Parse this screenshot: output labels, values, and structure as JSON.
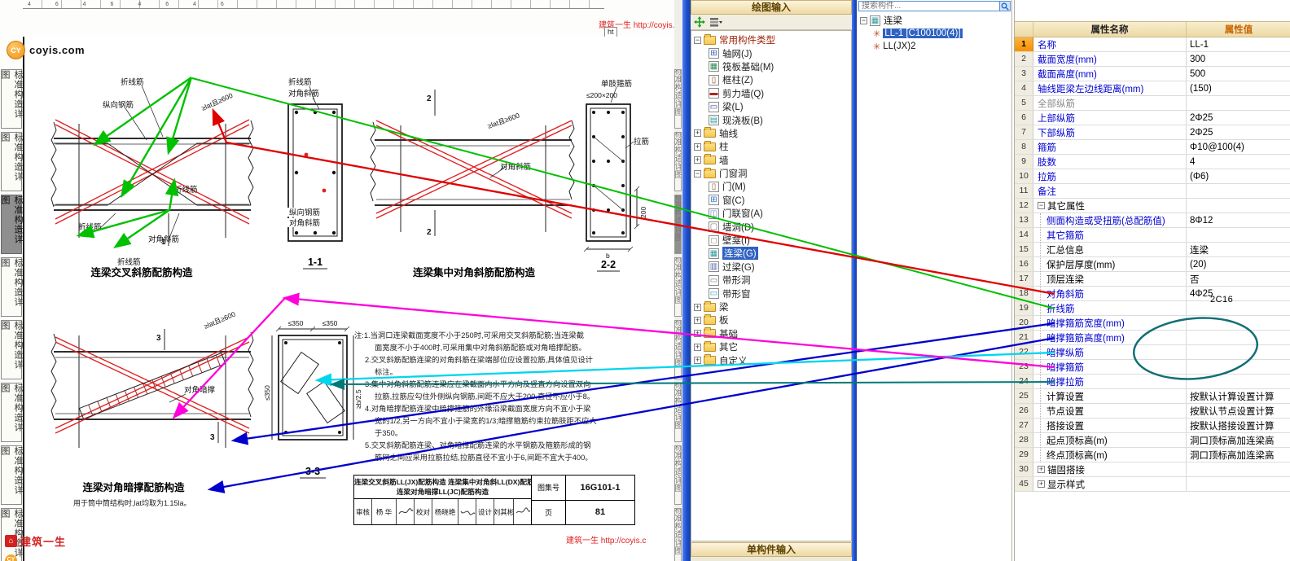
{
  "colors": {
    "arrow_green": "#00c000",
    "arrow_red": "#e00000",
    "arrow_blue": "#0000cc",
    "arrow_cyan": "#00d5ee",
    "arrow_magenta": "#ff00dd",
    "arrow_teal": "#007878",
    "ellipse_teal": "#136f75",
    "red_line": "#e02020",
    "selection_blue": "#2f62c2",
    "value_header_orange": "#c86400",
    "prop_blue": "#0000d0"
  },
  "doc": {
    "top_fragment": "4 6 4 6 4 6 4 6",
    "top_watermark": "建筑一生 http://coyis.",
    "top_tooltip": "ht",
    "logo_cy": "CY",
    "logo_site": "coyis.com",
    "side_tabs": [
      "标准构造详图",
      "标准构造详图",
      "标准构造详图",
      "标准构造详图",
      "标准构造详图",
      "标准构造详图",
      "标准构造详图",
      "标准构造详图"
    ],
    "side_tab_active_index": 2,
    "bottom_logo": "建筑一生",
    "bottom_watermark": "建筑一生 http://coyis.c",
    "labels": {
      "zhexianjin": "折线筋",
      "zongxiang": "纵向钢筋",
      "duijiao": "对角斜筋",
      "ancheng": "对角暗撑",
      "lajin": "拉筋",
      "danzhigujin": "单肢箍筋",
      "le200": "≤200×200",
      "dim600": "≥lat且≥600",
      "le350": "≤350",
      "geb25": "≥b/2.5",
      "d200": "200",
      "b": "b",
      "s1": "1",
      "s2": "2",
      "s3": "3",
      "c11": "1-1",
      "c22": "2-2",
      "c33": "3-3",
      "fig1_title": "连梁交叉斜筋配筋构造",
      "fig3_title": "连梁集中对角斜筋配筋构造",
      "fig5_title": "连梁对角暗撑配筋构造",
      "fig5_note": "用于筒中筒结构时,lat均取为1.15la。"
    },
    "notes": [
      {
        "t": "注:1.当洞口连梁截面宽度不小于250时,可采用交叉斜筋配筋;当连梁截",
        "i": 0
      },
      {
        "t": "面宽度不小于400时,可采用集中对角斜筋配筋或对角暗撑配筋。",
        "i": 2
      },
      {
        "t": "2.交叉斜筋配筋连梁的对角斜筋在梁端部位应设置拉筋,具体值见设计",
        "i": 1
      },
      {
        "t": "标注。",
        "i": 2
      },
      {
        "t": "3.集中对角斜筋配筋连梁应在梁截面内水平方向及竖直方向设置双向",
        "i": 1
      },
      {
        "t": "拉筋,拉筋应勾住外侧纵向钢筋,间距不应大于200,直径不应小于8。",
        "i": 2
      },
      {
        "t": "4.对角暗撑配筋连梁中暗撑箍筋的外缘沿梁截面宽度方向不宜小于梁",
        "i": 1
      },
      {
        "t": "宽的1/2,另一方向不宜小于梁宽的1/3;暗撑箍筋约束拉筋肢距不应大",
        "i": 2
      },
      {
        "t": "于350。",
        "i": 2
      },
      {
        "t": "5.交叉斜筋配筋连梁、对角暗撑配筋连梁的水平钢筋及箍筋形成的钢",
        "i": 1
      },
      {
        "t": "筋网之间应采用拉筋拉结,拉筋直径不宜小于6,间距不宜大于400。",
        "i": 2
      }
    ],
    "titleblock": {
      "line1": "连梁交叉斜筋LL(JX)配筋构造  连梁集中对角斜LL(DX)配筋构造",
      "line2": "连梁对角暗撑LL(JC)配筋构造",
      "atlas_label": "图集号",
      "atlas_no": "16G101-1",
      "page_label": "页",
      "page_no": "81",
      "review_label": "审核",
      "review_name": "杨 华",
      "check_label": "校对",
      "check_name": "杨晓艳",
      "design_label": "设计",
      "design_name": "刘其彬"
    }
  },
  "draw_panel": {
    "title": "绘图输入",
    "footer": "单构件输入",
    "tree": [
      {
        "label": "常用构件类型",
        "kind": "folder",
        "exp": "minus",
        "level": 0,
        "cat": true
      },
      {
        "label": "轴网(J)",
        "kind": "item",
        "icon": "axis-grid",
        "level": 1
      },
      {
        "label": "筏板基础(M)",
        "kind": "item",
        "icon": "raft-foundation",
        "level": 1
      },
      {
        "label": "框柱(Z)",
        "kind": "item",
        "icon": "frame-column",
        "level": 1
      },
      {
        "label": "剪力墙(Q)",
        "kind": "item",
        "icon": "shear-wall",
        "level": 1
      },
      {
        "label": "梁(L)",
        "kind": "item",
        "icon": "beam",
        "level": 1
      },
      {
        "label": "现浇板(B)",
        "kind": "item",
        "icon": "slab",
        "level": 1
      },
      {
        "label": "轴线",
        "kind": "folder",
        "exp": "plus",
        "level": 0
      },
      {
        "label": "柱",
        "kind": "folder",
        "exp": "plus",
        "level": 0
      },
      {
        "label": "墙",
        "kind": "folder",
        "exp": "plus",
        "level": 0
      },
      {
        "label": "门窗洞",
        "kind": "folder",
        "exp": "minus",
        "level": 0
      },
      {
        "label": "门(M)",
        "kind": "item",
        "icon": "door",
        "level": 1
      },
      {
        "label": "窗(C)",
        "kind": "item",
        "icon": "window",
        "level": 1
      },
      {
        "label": "门联窗(A)",
        "kind": "item",
        "icon": "door-window",
        "level": 1
      },
      {
        "label": "墙洞(D)",
        "kind": "item",
        "icon": "wall-hole",
        "level": 1
      },
      {
        "label": "壁龛(I)",
        "kind": "item",
        "icon": "niche",
        "level": 1
      },
      {
        "label": "连梁(G)",
        "kind": "item",
        "icon": "coupling-beam",
        "level": 1,
        "selected": true
      },
      {
        "label": "过梁(G)",
        "kind": "item",
        "icon": "lintel",
        "level": 1
      },
      {
        "label": "带形洞",
        "kind": "item",
        "icon": "strip-hole",
        "level": 1
      },
      {
        "label": "带形窗",
        "kind": "item",
        "icon": "strip-window",
        "level": 1
      },
      {
        "label": "梁",
        "kind": "folder",
        "exp": "plus",
        "level": 0
      },
      {
        "label": "板",
        "kind": "folder",
        "exp": "plus",
        "level": 0
      },
      {
        "label": "基础",
        "kind": "folder",
        "exp": "plus",
        "level": 0
      },
      {
        "label": "其它",
        "kind": "folder",
        "exp": "plus",
        "level": 0
      },
      {
        "label": "自定义",
        "kind": "folder",
        "exp": "plus",
        "level": 0
      }
    ]
  },
  "component_panel": {
    "search_placeholder": "搜索构件...",
    "root_label": "连梁",
    "items": [
      {
        "label": "LL-1 [C100100(4)]",
        "selected": true
      },
      {
        "label": "LL(JX)2",
        "selected": false
      }
    ]
  },
  "prop_panel": {
    "name_header": "属性名称",
    "value_header": "属性值",
    "rows": [
      {
        "n": "1",
        "name": "名称",
        "value": "LL-1",
        "c": "b",
        "hl": true
      },
      {
        "n": "2",
        "name": "截面宽度(mm)",
        "value": "300",
        "c": "b"
      },
      {
        "n": "3",
        "name": "截面高度(mm)",
        "value": "500",
        "c": "b"
      },
      {
        "n": "4",
        "name": "轴线距梁左边线距离(mm)",
        "value": "(150)",
        "c": "b"
      },
      {
        "n": "5",
        "name": "全部纵筋",
        "value": "",
        "c": "g"
      },
      {
        "n": "6",
        "name": "上部纵筋",
        "value": "2Φ25",
        "c": "b"
      },
      {
        "n": "7",
        "name": "下部纵筋",
        "value": "2Φ25",
        "c": "b"
      },
      {
        "n": "8",
        "name": "箍筋",
        "value": "Φ10@100(4)",
        "c": "b"
      },
      {
        "n": "9",
        "name": "肢数",
        "value": "4",
        "c": "b"
      },
      {
        "n": "10",
        "name": "拉筋",
        "value": "(Φ6)",
        "c": "b"
      },
      {
        "n": "11",
        "name": "备注",
        "value": "",
        "c": "b"
      },
      {
        "n": "12",
        "name": "其它属性",
        "value": "",
        "c": "k",
        "exp": "minus"
      },
      {
        "n": "13",
        "name": "侧面构造或受扭筋(总配筋值)",
        "value": "8Φ12",
        "c": "b",
        "child": true
      },
      {
        "n": "14",
        "name": "其它箍筋",
        "value": "",
        "c": "b",
        "child": true
      },
      {
        "n": "15",
        "name": "汇总信息",
        "value": "连梁",
        "c": "k",
        "child": true
      },
      {
        "n": "16",
        "name": "保护层厚度(mm)",
        "value": "(20)",
        "c": "k",
        "child": true
      },
      {
        "n": "17",
        "name": "顶层连梁",
        "value": "否",
        "c": "k",
        "child": true
      },
      {
        "n": "18",
        "name": "对角斜筋",
        "value": "4Φ25",
        "c": "b",
        "child": true
      },
      {
        "n": "19",
        "name": "折线筋",
        "value": "",
        "c": "b",
        "child": true
      },
      {
        "n": "20",
        "name": "暗撑箍筋宽度(mm)",
        "value": "",
        "c": "b",
        "child": true
      },
      {
        "n": "21",
        "name": "暗撑箍筋高度(mm)",
        "value": "",
        "c": "b",
        "child": true
      },
      {
        "n": "22",
        "name": "暗撑纵筋",
        "value": "",
        "c": "b",
        "child": true
      },
      {
        "n": "23",
        "name": "暗撑箍筋",
        "value": "",
        "c": "b",
        "child": true
      },
      {
        "n": "24",
        "name": "暗撑拉筋",
        "value": "",
        "c": "b",
        "child": true
      },
      {
        "n": "25",
        "name": "计算设置",
        "value": "按默认计算设置计算",
        "c": "k",
        "child": true
      },
      {
        "n": "26",
        "name": "节点设置",
        "value": "按默认节点设置计算",
        "c": "k",
        "child": true
      },
      {
        "n": "27",
        "name": "搭接设置",
        "value": "按默认搭接设置计算",
        "c": "k",
        "child": true
      },
      {
        "n": "28",
        "name": "起点顶标高(m)",
        "value": "洞口顶标高加连梁高",
        "c": "k",
        "child": true
      },
      {
        "n": "29",
        "name": "终点顶标高(m)",
        "value": "洞口顶标高加连梁高",
        "c": "k",
        "child": true
      },
      {
        "n": "30",
        "name": "锚固搭接",
        "value": "",
        "c": "k",
        "exp": "plus"
      },
      {
        "n": "45",
        "name": "显示样式",
        "value": "",
        "c": "k",
        "exp": "plus"
      }
    ]
  },
  "annotations": {
    "handwritten_value": "2C16"
  }
}
